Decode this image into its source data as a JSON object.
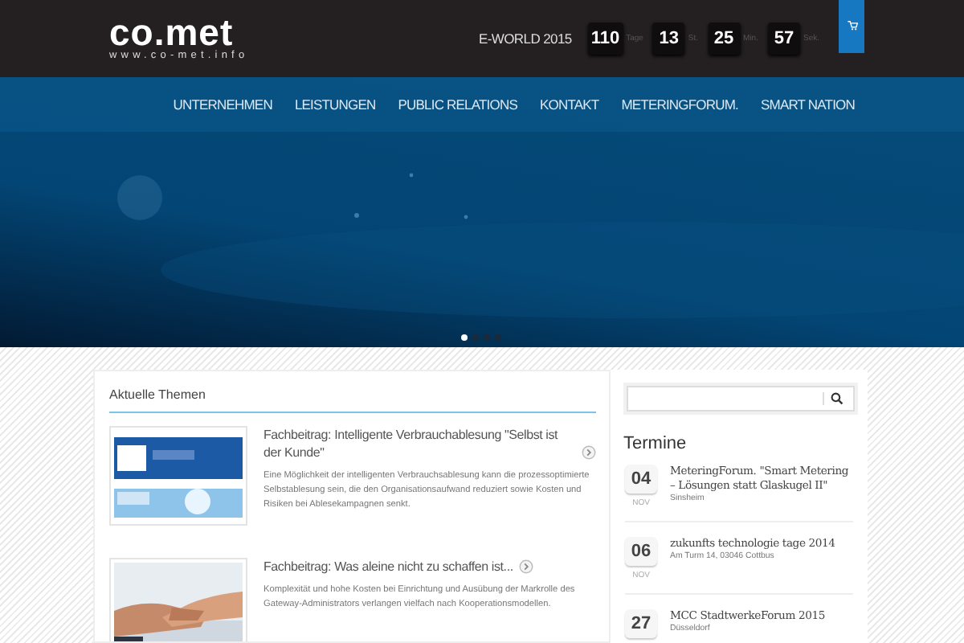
{
  "header": {
    "logo": "co.met",
    "logo_url": "www.co-met.info",
    "event": "E-WORLD 2015",
    "countdown": [
      {
        "value": "110",
        "unit": "Tage"
      },
      {
        "value": "13",
        "unit": "St."
      },
      {
        "value": "25",
        "unit": "Min."
      },
      {
        "value": "57",
        "unit": "Sek."
      }
    ]
  },
  "nav": {
    "items": [
      {
        "label": "UNTERNEHMEN"
      },
      {
        "label": "LEISTUNGEN"
      },
      {
        "label": "PUBLIC RELATIONS"
      },
      {
        "label": "KONTAKT"
      },
      {
        "label": "METERINGFORUM."
      },
      {
        "label": "SMART NATION"
      }
    ]
  },
  "slider": {
    "dots": [
      {
        "selected": true
      },
      {
        "selected": false
      },
      {
        "selected": false
      },
      {
        "selected": false
      }
    ]
  },
  "topics": {
    "title": "Aktuelle Themen",
    "articles": [
      {
        "title": "Fachbeitrag: Intelligente Verbrauchablesung \"Selbst ist der Kunde\"",
        "text": "Eine Möglichkeit der intelligenten Verbrauchsablesung kann die prozessoptimierte Selbstablesung sein, die den Organisationsaufwand reduziert sowie Kosten und Risiken bei Ablesekampagnen senkt."
      },
      {
        "title": "Fachbeitrag: Was aleine nicht zu schaffen ist...",
        "text": "Komplexität und hohe Kosten bei Einrichtung und Ausübung der Markrolle des Gateway-Administrators verlangen vielfach nach Kooperationsmodellen."
      }
    ]
  },
  "sidebar": {
    "title": "Termine",
    "events": [
      {
        "day": "04",
        "month": "NOV",
        "title": "MeteringForum. \"Smart Metering – Lösungen statt Glaskugel II\"",
        "place": "Sinsheim"
      },
      {
        "day": "06",
        "month": "NOV",
        "title": "zukunfts technologie tage 2014",
        "place": "Am Turm 14, 03046 Cottbus"
      },
      {
        "day": "27",
        "title": "MCC StadtwerkeForum 2015",
        "place": "Düsseldorf"
      }
    ]
  }
}
